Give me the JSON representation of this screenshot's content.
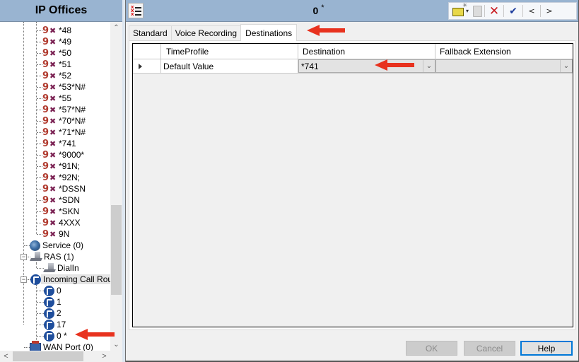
{
  "left_panel": {
    "title": "IP Offices",
    "short_codes": [
      "*48",
      "*49",
      "*50",
      "*51",
      "*52",
      "*53*N#",
      "*55",
      "*57*N#",
      "*70*N#",
      "*71*N#",
      "*741",
      "*9000*",
      "*91N;",
      "*92N;",
      "*DSSN",
      "*SDN",
      "*SKN",
      "4XXX",
      "9N"
    ],
    "service": "Service (0)",
    "ras": "RAS (1)",
    "ras_children": [
      "DialIn"
    ],
    "incoming_call_route": "Incoming Call Route",
    "icr_children": [
      "0",
      "1",
      "2",
      "17",
      "0 *"
    ],
    "wan_port": "WAN Port (0)",
    "expander_symbol": "−",
    "scroll_up": "⌃",
    "scroll_down": "⌄",
    "scroll_left": "<",
    "scroll_right": ">"
  },
  "right_panel": {
    "title": "0",
    "title_marker": "*",
    "toolbar": {
      "dropdown_arrow": "▾",
      "delete_glyph": "✕",
      "ok_glyph": "✔",
      "prev_glyph": "<",
      "next_glyph": ">"
    },
    "tabs": [
      {
        "label": "Standard",
        "active": false
      },
      {
        "label": "Voice Recording",
        "active": false
      },
      {
        "label": "Destinations",
        "active": true
      }
    ],
    "grid": {
      "columns": [
        "",
        "TimeProfile",
        "Destination",
        "Fallback Extension"
      ],
      "rows": [
        {
          "time_profile": "Default Value",
          "destination": "*741",
          "fallback_extension": ""
        }
      ],
      "combo_arrow": "⌄"
    },
    "buttons": {
      "ok": "OK",
      "cancel": "Cancel",
      "help": "Help"
    }
  },
  "colors": {
    "header_bg": "#99b4d1",
    "annotation_arrow": "#e8321e",
    "focus_border": "#0078d7"
  }
}
